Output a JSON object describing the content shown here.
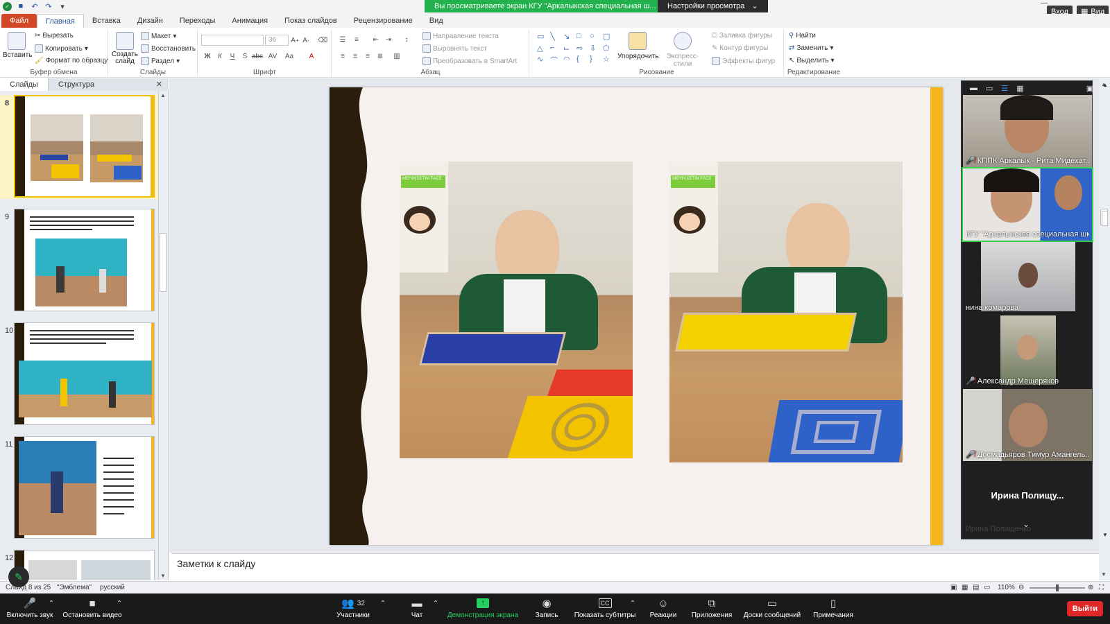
{
  "zoom_banner": {
    "share_text": "Вы просматриваете экран КГУ \"Аркалыкская специальная ш...",
    "view_settings": "Настройки просмотра",
    "login": "Вход",
    "view": "Вид"
  },
  "ribbon_tabs": [
    "Файл",
    "Главная",
    "Вставка",
    "Дизайн",
    "Переходы",
    "Анимация",
    "Показ слайдов",
    "Рецензирование",
    "Вид"
  ],
  "ribbon": {
    "clipboard": {
      "label": "Буфер обмена",
      "paste": "Вставить",
      "cut": "Вырезать",
      "copy": "Копировать",
      "format_painter": "Формат по образцу"
    },
    "slides": {
      "label": "Слайды",
      "new_slide": "Создать слайд",
      "layout": "Макет",
      "reset": "Восстановить",
      "section": "Раздел"
    },
    "font": {
      "label": "Шрифт",
      "size": "36"
    },
    "paragraph": {
      "label": "Абзац",
      "text_direction": "Направление текста",
      "align_text": "Выровнять текст",
      "convert_smartart": "Преобразовать в SmartArt"
    },
    "drawing": {
      "label": "Рисование",
      "arrange": "Упорядочить",
      "quick_styles": "Экспресс-стили",
      "shape_fill": "Заливка фигуры",
      "shape_outline": "Контур фигуры",
      "shape_effects": "Эффекты фигур"
    },
    "editing": {
      "label": "Редактирование",
      "find": "Найти",
      "replace": "Заменить",
      "select": "Выделить"
    }
  },
  "left_panel": {
    "tabs": [
      "Слайды",
      "Структура"
    ],
    "thumbnails": [
      {
        "num": "8"
      },
      {
        "num": "9"
      },
      {
        "num": "10"
      },
      {
        "num": "11"
      },
      {
        "num": "12"
      }
    ]
  },
  "notes_placeholder": "Заметки к слайду",
  "status": {
    "slide": "Слайд 8 из 25",
    "theme": "\"Эмблема\"",
    "language": "русский",
    "zoom": "110%"
  },
  "participants": [
    {
      "name": "КППК Аркалык - Рита Мидехат...",
      "muted": true
    },
    {
      "name": "КГУ \"Аркалыкская специальная шк...",
      "muted": false
    },
    {
      "name": "нина комарова",
      "muted": false
    },
    {
      "name": "Александр Мещеряков",
      "muted": true
    },
    {
      "name": "Досмадьяров Тимур Амангель...",
      "muted": true
    }
  ],
  "participant_big_name": "Ирина  Полищу...",
  "participant_faint_name": "Ирина Полищенко",
  "zoom_controls": {
    "unmute": "Включить звук",
    "stop_video": "Остановить видео",
    "participants": "Участники",
    "participants_count": "32",
    "chat": "Чат",
    "share": "Демонстрация экрана",
    "record": "Запись",
    "captions": "Показать субтитры",
    "reactions": "Реакции",
    "apps": "Приложения",
    "whiteboards": "Доски сообщений",
    "notes": "Примечания",
    "leave": "Выйти"
  },
  "slide_photos": {
    "poster_text": "МЕНІҢ БЕТІМ FACE"
  },
  "colors": {
    "accent_orange": "#f4b41a",
    "dark_band": "#2a1d0c",
    "zoom_green": "#22b14c",
    "leave_red": "#e02828"
  }
}
